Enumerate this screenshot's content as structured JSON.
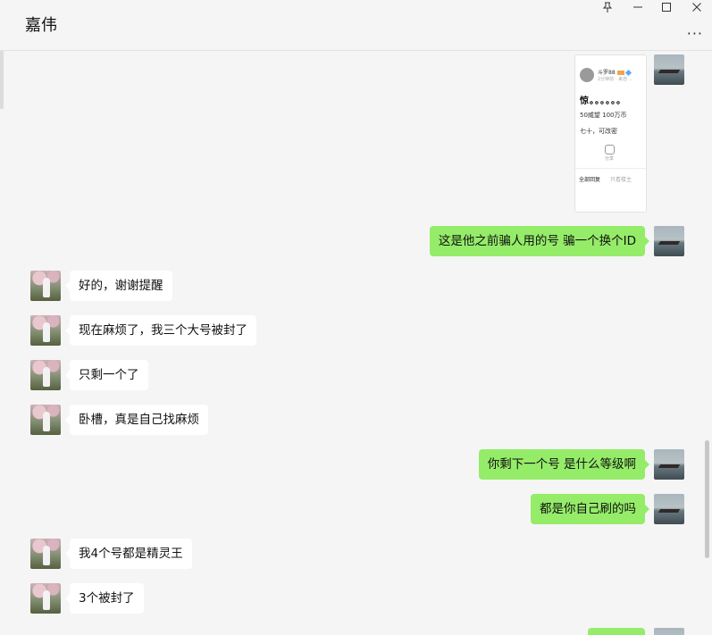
{
  "window": {
    "title": "嘉伟",
    "more_label": "···"
  },
  "icons": {
    "pin": "pin-icon",
    "minimize": "minimize-icon",
    "maximize": "maximize-icon",
    "close": "close-icon"
  },
  "colors": {
    "outgoing_bubble": "#95ec69",
    "incoming_bubble": "#ffffff",
    "background": "#f5f5f5"
  },
  "shared_card": {
    "name": "斗罗88",
    "meta": "2分钟前 · 来自 ...",
    "title": "惊。。。。。。",
    "line1": "50威望 100万币",
    "line2": "七十，可改密",
    "share_label": "分享",
    "tab_all": "全部回复",
    "tab_op": "只看楼主"
  },
  "messages": [
    {
      "side": "out",
      "text": "这是他之前骗人用的号  骗一个换个ID"
    },
    {
      "side": "in",
      "text": "好的，谢谢提醒"
    },
    {
      "side": "in",
      "text": "现在麻烦了，我三个大号被封了"
    },
    {
      "side": "in",
      "text": "只剩一个了"
    },
    {
      "side": "in",
      "text": "卧槽，真是自己找麻烦"
    },
    {
      "side": "out",
      "text": "你剩下一个号 是什么等级啊"
    },
    {
      "side": "out",
      "text": "都是你自己刷的吗"
    },
    {
      "side": "in",
      "text": "我4个号都是精灵王"
    },
    {
      "side": "in",
      "text": "3个被封了"
    }
  ]
}
